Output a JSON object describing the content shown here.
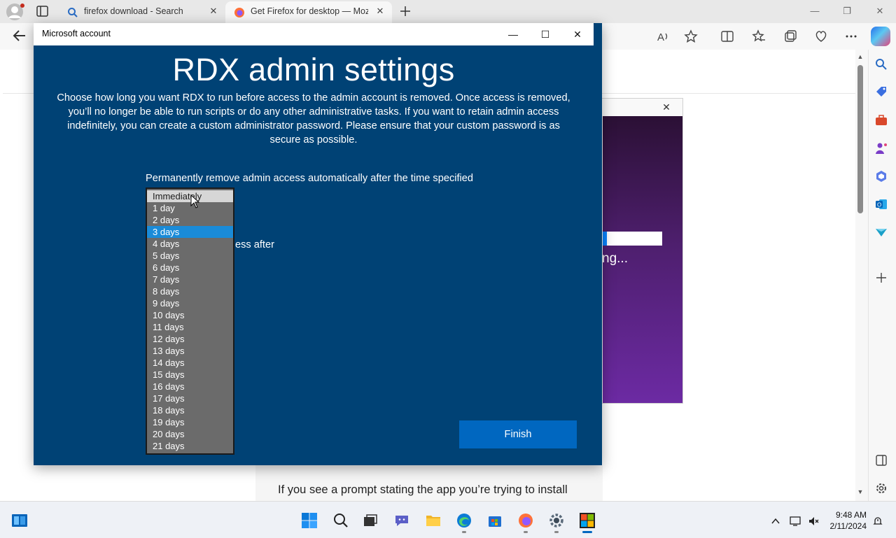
{
  "browser": {
    "tabs": [
      {
        "title": "firefox download - Search",
        "favicon": "search-icon",
        "active": false
      },
      {
        "title": "Get Firefox for desktop — Mozill",
        "favicon": "firefox-icon",
        "active": true
      }
    ],
    "close_glyph": "✕",
    "window_controls": {
      "minimize": "—",
      "restore": "❐",
      "close": "✕"
    }
  },
  "background_page": {
    "installer": {
      "close_glyph": "✕",
      "status_text": "ng...",
      "progress": 0.07
    },
    "article_text": "If you see a prompt stating the app you’re trying to install"
  },
  "dialog": {
    "window_title": "Microsoft account",
    "controls": {
      "minimize": "—",
      "maximize": "☐",
      "close": "✕"
    },
    "heading": "RDX admin settings",
    "description": "Choose how long you want RDX to run before access to the admin account is removed. Once access is removed, you’ll no longer be able to run scripts or do any other administrative tasks. If you want to retain admin access indefinitely, you can create a custom administrator password. Please ensure that your custom password is as secure as possible.",
    "dropdown_label": "Permanently remove admin access automatically after the time specified",
    "partial_label": "ess after",
    "options": [
      "Immediately",
      "1 day",
      "2 days",
      "3 days",
      "4 days",
      "5 days",
      "6 days",
      "7 days",
      "8 days",
      "9 days",
      "10 days",
      "11 days",
      "12 days",
      "13 days",
      "14 days",
      "15 days",
      "16 days",
      "17 days",
      "18 days",
      "19 days",
      "20 days",
      "21 days"
    ],
    "hovered_option": "Immediately",
    "selected_option": "3 days",
    "finish_label": "Finish",
    "colors": {
      "background": "#004275",
      "button": "#0067c0",
      "selected": "#1a8bd8"
    }
  },
  "taskbar": {
    "time": "9:48 AM",
    "date": "2/11/2024"
  }
}
